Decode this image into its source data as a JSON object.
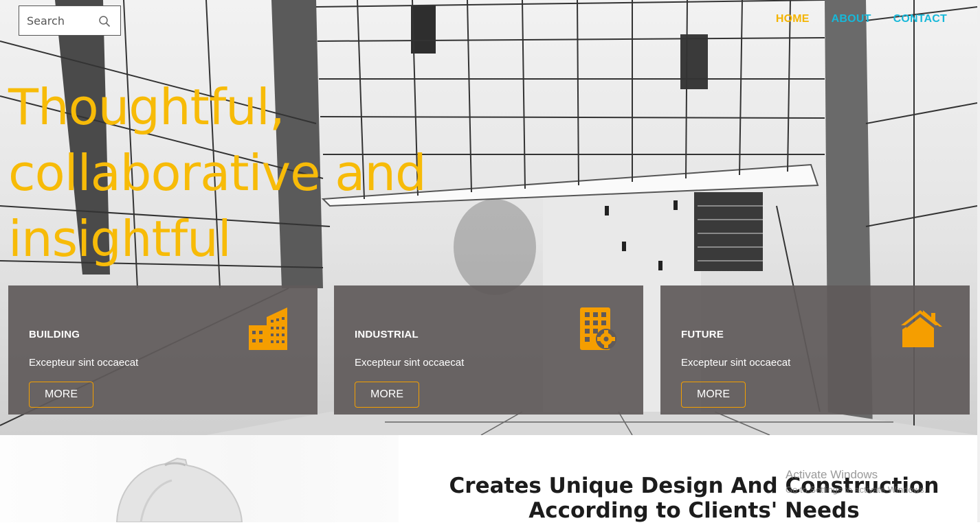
{
  "search": {
    "placeholder": "Search"
  },
  "nav": {
    "items": [
      {
        "label": "HOME",
        "active": true
      },
      {
        "label": "ABOUT",
        "active": false
      },
      {
        "label": "CONTACT",
        "active": false
      }
    ]
  },
  "hero": {
    "headline": "Thoughtful, collaborative and insightful"
  },
  "cards": [
    {
      "title": "BUILDING",
      "text": "Excepteur sint occaecat",
      "button": "MORE",
      "icon": "buildings-icon"
    },
    {
      "title": "INDUSTRIAL",
      "text": "Excepteur sint occaecat",
      "button": "MORE",
      "icon": "office-gear-icon"
    },
    {
      "title": "FUTURE",
      "text": "Excepteur sint occaecat",
      "button": "MORE",
      "icon": "house-icon"
    }
  ],
  "section": {
    "title": "Creates Unique Design And Construction According to Clients' Needs"
  },
  "watermark": {
    "title": "Activate Windows",
    "subtitle": "Go to Settings to activate Windows."
  },
  "colors": {
    "accent": "#f7bb08",
    "nav_link": "#17b8d9",
    "icon_orange": "#f59e00",
    "card_bg": "#605a5a"
  }
}
